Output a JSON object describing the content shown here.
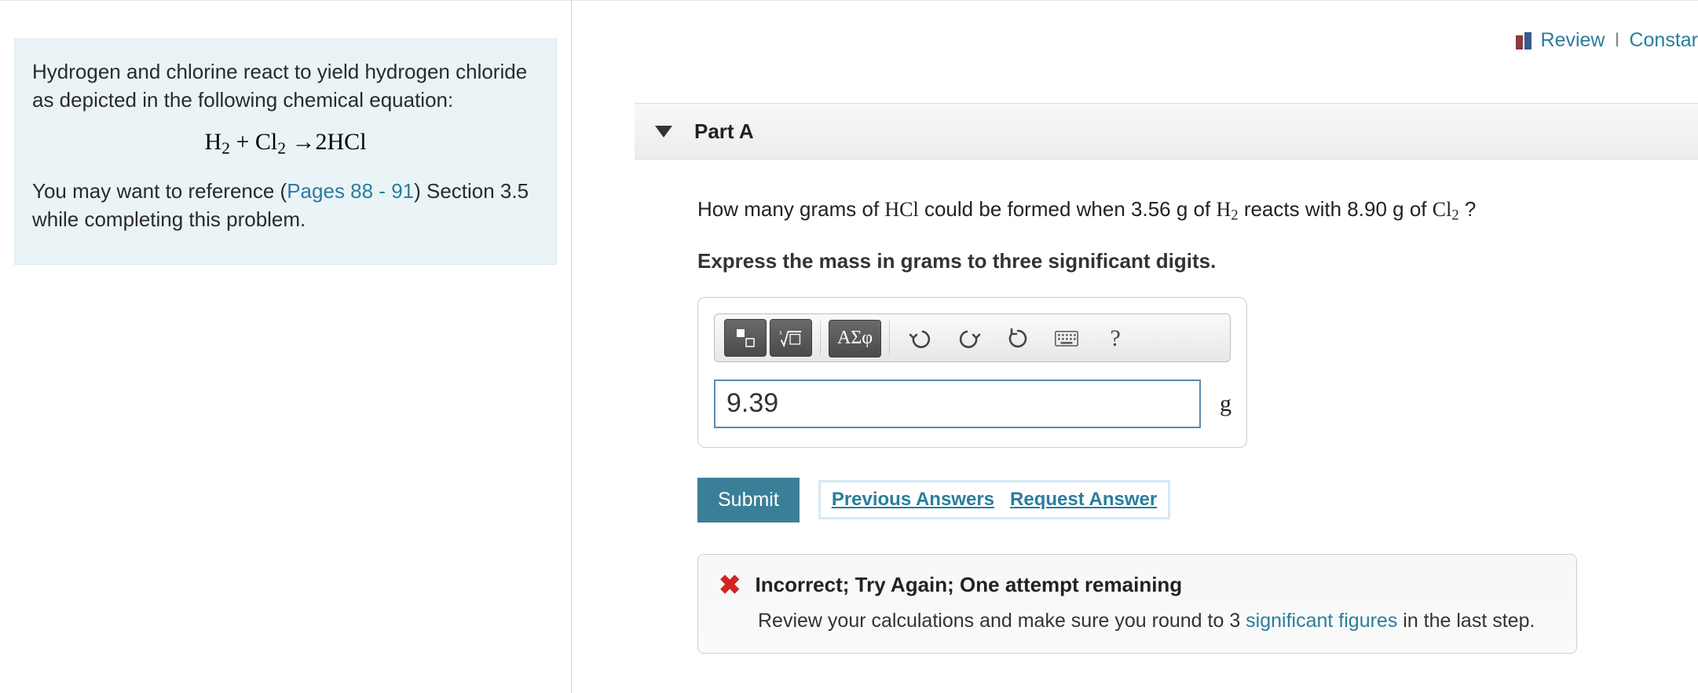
{
  "topLinks": {
    "review": "Review",
    "constants": "Constar"
  },
  "leftInfo": {
    "intro": "Hydrogen and chlorine react to yield hydrogen chloride as depicted in the following chemical equation:",
    "eq_h2": "H",
    "eq_sub2a": "2",
    "eq_plus": " + ",
    "eq_cl": "Cl",
    "eq_sub2b": "2",
    "eq_arrow": " →",
    "eq_rhs_coef": "2",
    "eq_rhs": "HCl",
    "ref_pre": "You may want to reference (",
    "ref_link": "Pages 88 - 91",
    "ref_post": ") Section 3.5 while completing this problem."
  },
  "part": {
    "label": "Part A"
  },
  "question": {
    "pre": "How many grams of ",
    "hcl": "HCl",
    "mid1": " could be formed when 3.56 g of ",
    "h2": "H",
    "h2_sub": "2",
    "mid2": "  reacts with 8.90 g of ",
    "cl2": "Cl",
    "cl2_sub": "2",
    "end": " ?"
  },
  "instruction": "Express the mass in grams to three significant digits.",
  "toolbar": {
    "templates": "▮",
    "root": "√",
    "greek": "ΑΣφ",
    "help": "?"
  },
  "answer": {
    "value": "9.39",
    "unit": "g"
  },
  "actions": {
    "submit": "Submit",
    "previous": "Previous Answers",
    "request": "Request Answer"
  },
  "feedback": {
    "title": "Incorrect; Try Again; One attempt remaining",
    "body_pre": "Review your calculations and make sure you round to 3 ",
    "sig": "significant figures",
    "body_post": " in the last step."
  }
}
